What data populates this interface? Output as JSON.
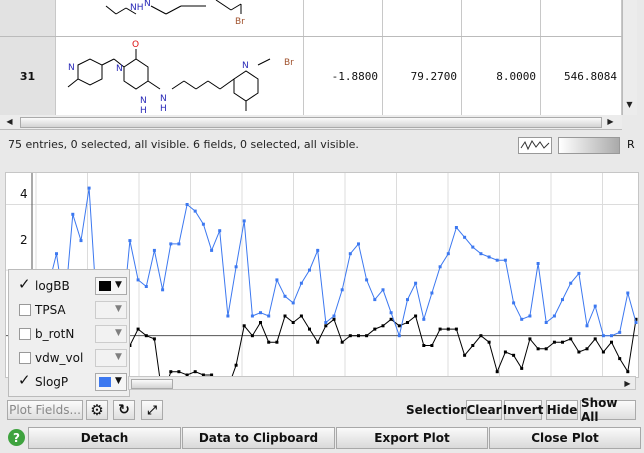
{
  "table": {
    "rows": [
      {
        "id": "",
        "values": [
          "",
          "",
          "",
          ""
        ]
      },
      {
        "id": "31",
        "values": [
          "-1.8800",
          "79.2700",
          "8.0000",
          "546.8084"
        ]
      }
    ]
  },
  "status": {
    "text": "75 entries, 0 selected, all visible. 6 fields, 0 selected, all visible.",
    "r_label": "R"
  },
  "plot": {
    "y_ticks": [
      "4",
      "2"
    ],
    "legend": [
      {
        "name": "logBB",
        "checked": true,
        "color": "#000000"
      },
      {
        "name": "TPSA",
        "checked": false,
        "color": ""
      },
      {
        "name": "b_rotN",
        "checked": false,
        "color": ""
      },
      {
        "name": "vdw_vol",
        "checked": false,
        "color": ""
      },
      {
        "name": "SlogP",
        "checked": true,
        "color": "#3c78f0"
      }
    ]
  },
  "chart_data": {
    "type": "line",
    "ylim": [
      -1.2,
      4.9
    ],
    "series": [
      {
        "name": "logBB",
        "color": "#000000",
        "values": [
          0.8,
          0.9,
          0.8,
          0.9,
          0.8,
          0.5,
          -0.4,
          -0.4,
          -0.4,
          -0.5,
          -0.4,
          -0.3,
          -0.3,
          0.2,
          0.0,
          -0.1,
          -1.9,
          -1.1,
          -1.1,
          -1.2,
          -1.1,
          -1.2,
          -1.2,
          -1.8,
          -1.6,
          -0.9,
          0.3,
          0.0,
          0.4,
          -0.2,
          -0.2,
          0.6,
          0.4,
          0.6,
          0.2,
          -0.2,
          0.3,
          0.5,
          -0.2,
          0.0,
          0.0,
          0.0,
          0.2,
          0.3,
          0.5,
          0.3,
          0.4,
          0.6,
          -0.3,
          -0.3,
          0.2,
          0.2,
          0.2,
          -0.6,
          -0.3,
          0.0,
          -0.2,
          -1.1,
          -0.5,
          -0.6,
          -1.0,
          -0.1,
          -0.4,
          -0.4,
          -0.2,
          -0.2,
          -0.1,
          -0.5,
          -0.4,
          -0.1,
          -0.5,
          -0.2,
          -0.7,
          -1.1,
          0.5
        ]
      },
      {
        "name": "SlogP",
        "color": "#3c78f0",
        "values": [
          1.0,
          1.6,
          1.5,
          2.5,
          0.8,
          3.7,
          2.9,
          4.5,
          0.6,
          0.5,
          0.0,
          0.3,
          2.9,
          1.7,
          1.5,
          2.6,
          1.4,
          2.8,
          2.8,
          4.0,
          3.8,
          3.4,
          2.6,
          3.2,
          0.6,
          2.1,
          3.5,
          0.6,
          0.7,
          0.6,
          1.7,
          1.2,
          1.0,
          1.6,
          2.0,
          2.6,
          0.4,
          0.6,
          1.4,
          2.5,
          2.8,
          1.7,
          1.1,
          1.4,
          0.7,
          0.0,
          1.1,
          1.6,
          0.5,
          1.3,
          2.1,
          2.5,
          3.3,
          3.0,
          2.7,
          2.5,
          2.4,
          2.3,
          2.3,
          1.0,
          0.5,
          0.6,
          2.2,
          0.4,
          0.6,
          1.1,
          1.6,
          1.9,
          0.3,
          0.9,
          0.0,
          0.0,
          0.1,
          1.3,
          0.4
        ]
      }
    ],
    "grid": true
  },
  "controls": {
    "plot_fields": "Plot Fields...",
    "selection_label": "Selection:",
    "clear": "Clear",
    "invert": "Invert",
    "hide": "Hide",
    "show_all": "Show All"
  },
  "bottom": {
    "detach": "Detach",
    "clipboard": "Data to Clipboard",
    "export": "Export Plot",
    "close": "Close Plot",
    "help_icon": "?"
  }
}
